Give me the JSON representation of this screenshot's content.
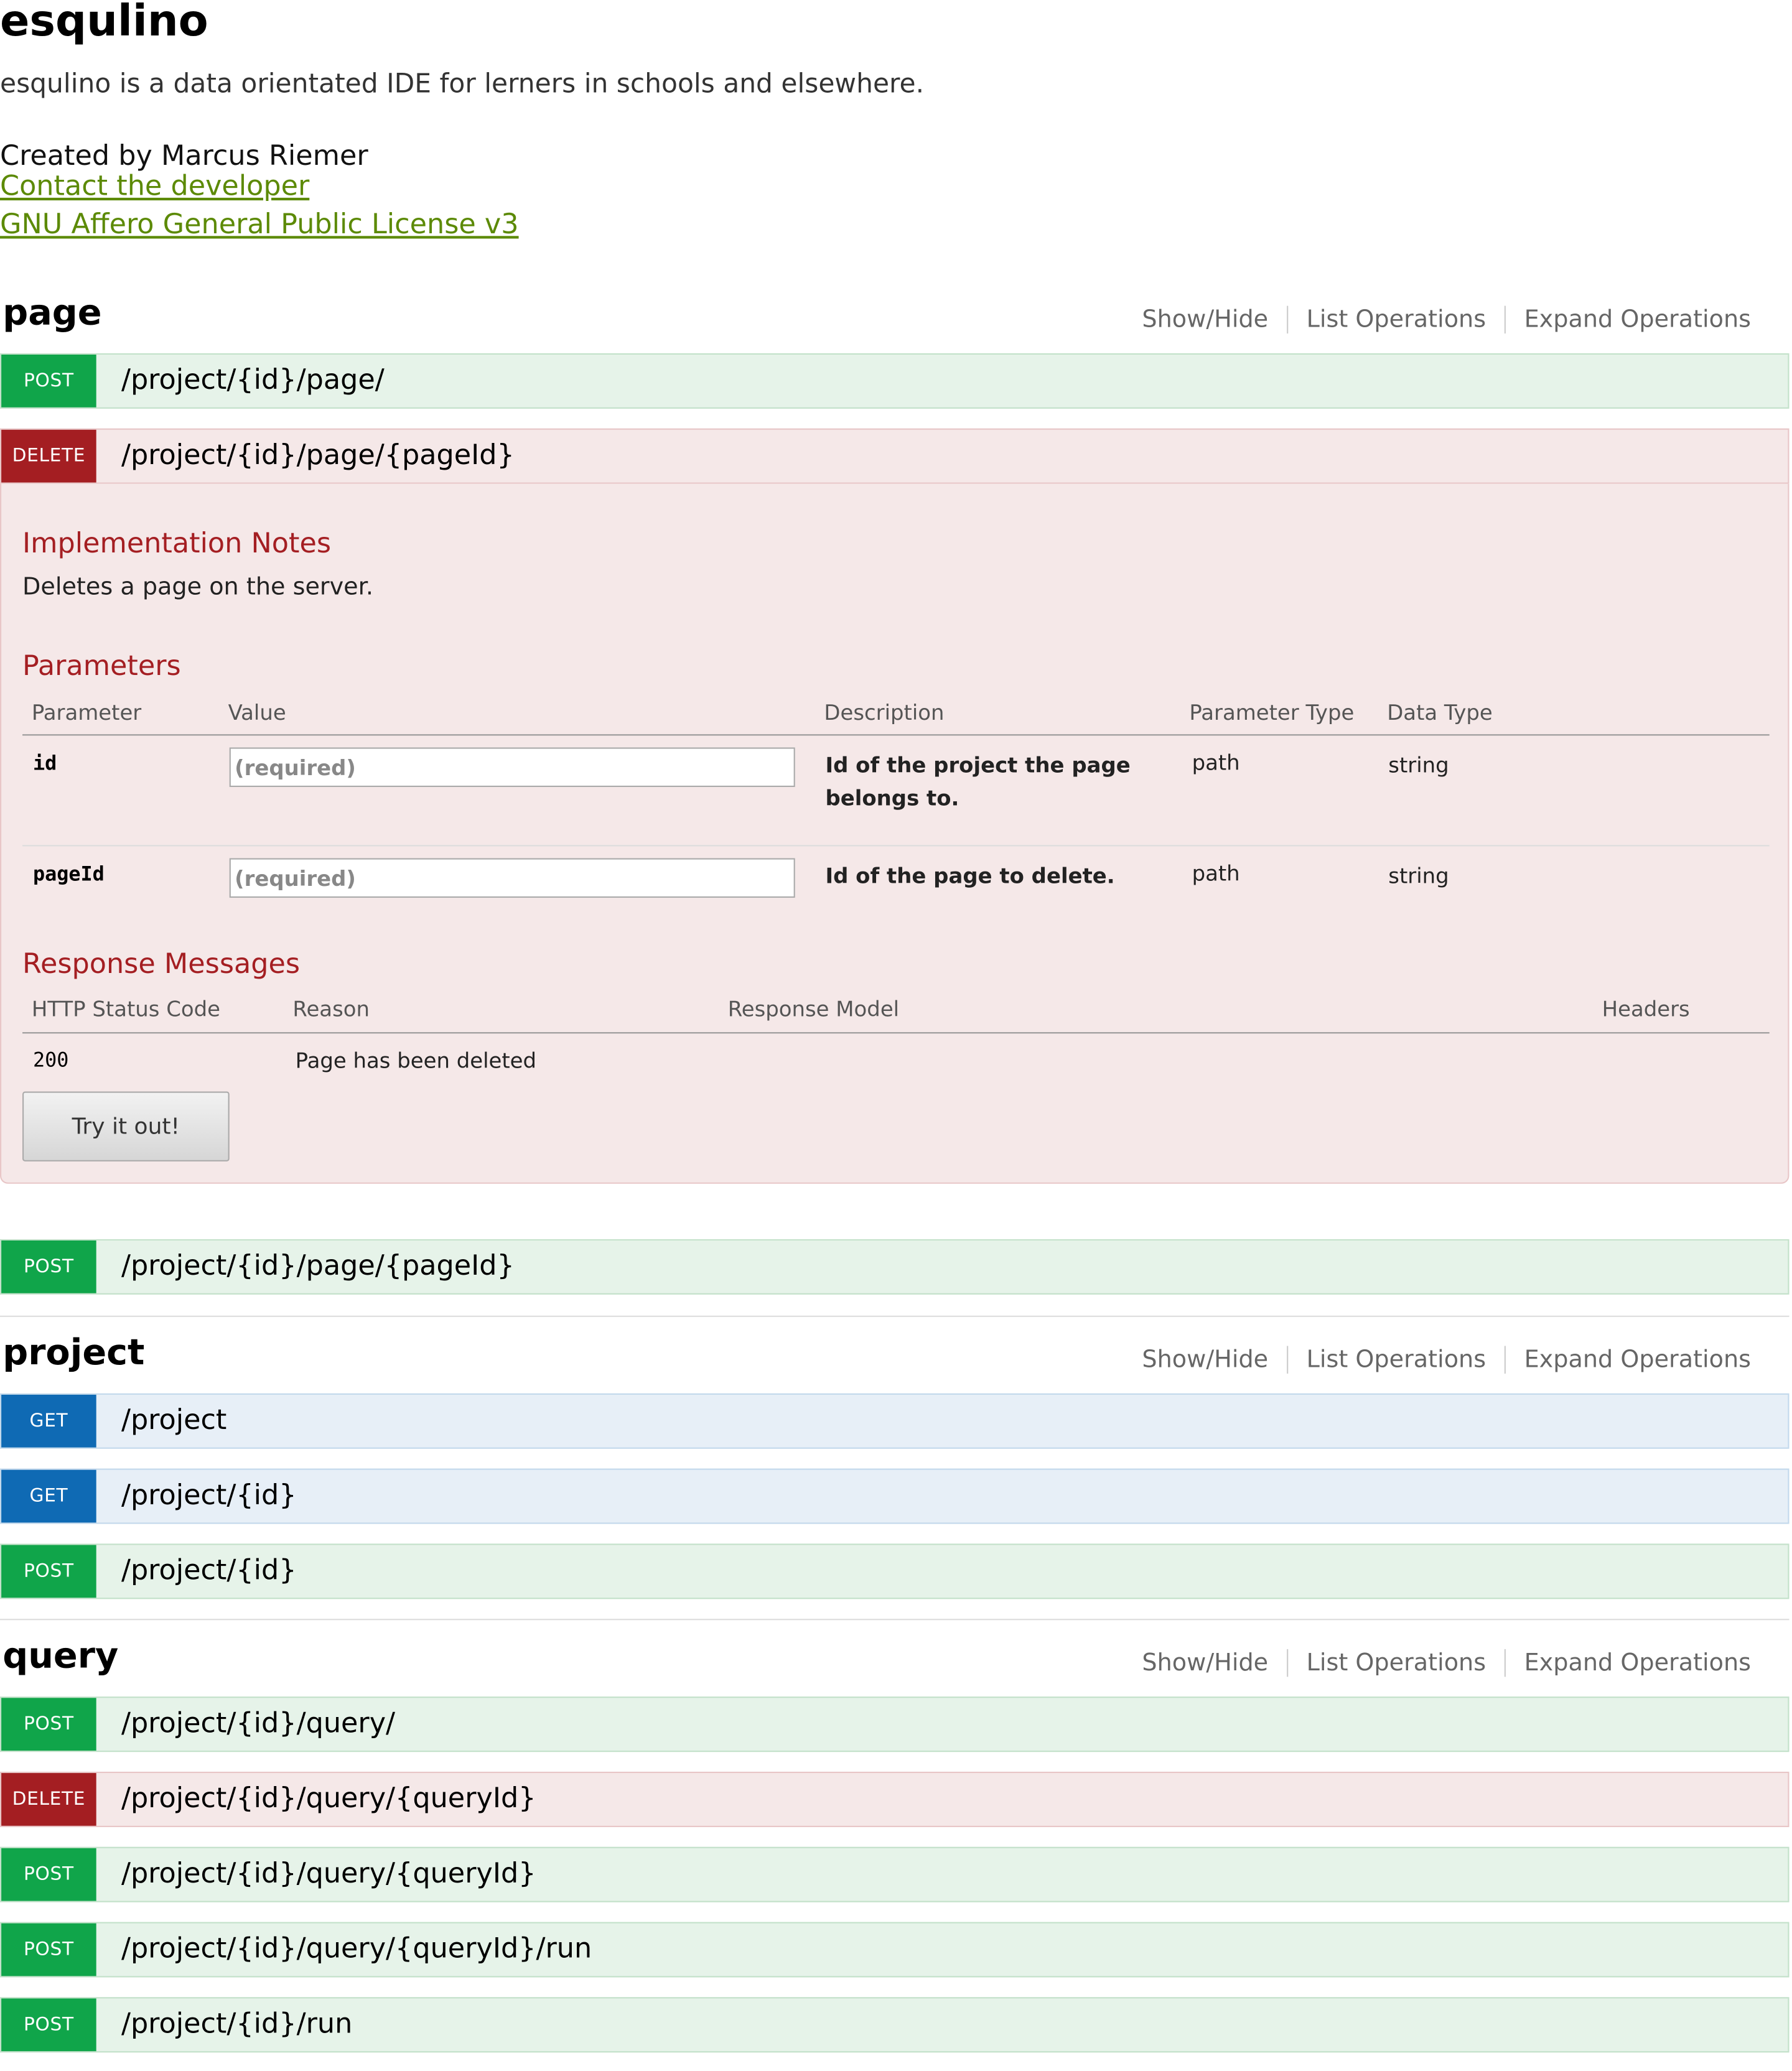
{
  "header": {
    "title": "esqulino",
    "description": "esqulino is a data orientated IDE for lerners in schools and elsewhere.",
    "created_by": "Created by Marcus Riemer",
    "contact_link": "Contact the developer",
    "license_link": "GNU Affero General Public License v3"
  },
  "resource_links": {
    "show_hide": "Show/Hide",
    "list_operations": "List Operations",
    "expand_operations": "Expand Operations"
  },
  "resources": [
    {
      "name": "page",
      "operations": [
        {
          "method": "POST",
          "path": "/project/{id}/page/"
        },
        {
          "method": "DELETE",
          "path": "/project/{id}/page/{pageId}"
        },
        {
          "method": "POST",
          "path": "/project/{id}/page/{pageId}"
        }
      ]
    },
    {
      "name": "project",
      "operations": [
        {
          "method": "GET",
          "path": "/project"
        },
        {
          "method": "GET",
          "path": "/project/{id}"
        },
        {
          "method": "POST",
          "path": "/project/{id}"
        }
      ]
    },
    {
      "name": "query",
      "operations": [
        {
          "method": "POST",
          "path": "/project/{id}/query/"
        },
        {
          "method": "DELETE",
          "path": "/project/{id}/query/{queryId}"
        },
        {
          "method": "POST",
          "path": "/project/{id}/query/{queryId}"
        },
        {
          "method": "POST",
          "path": "/project/{id}/query/{queryId}/run"
        },
        {
          "method": "POST",
          "path": "/project/{id}/run"
        }
      ]
    }
  ],
  "expanded": {
    "implementation_notes_title": "Implementation Notes",
    "implementation_notes": "Deletes a page on the server.",
    "parameters_title": "Parameters",
    "param_headers": {
      "parameter": "Parameter",
      "value": "Value",
      "description": "Description",
      "parameter_type": "Parameter Type",
      "data_type": "Data Type"
    },
    "parameters": [
      {
        "name": "id",
        "placeholder": "(required)",
        "description": "Id of the project the page belongs to.",
        "param_type": "path",
        "data_type": "string"
      },
      {
        "name": "pageId",
        "placeholder": "(required)",
        "description": "Id of the page to delete.",
        "param_type": "path",
        "data_type": "string"
      }
    ],
    "responses_title": "Response Messages",
    "response_headers": {
      "status_code": "HTTP Status Code",
      "reason": "Reason",
      "model": "Response Model",
      "headers": "Headers"
    },
    "responses": [
      {
        "code": "200",
        "reason": "Page has been deleted"
      }
    ],
    "try_button": "Try it out!"
  },
  "colors": {
    "post": "#10a54a",
    "delete": "#a41e22",
    "get": "#0f6ab4",
    "link": "#5c8a06"
  }
}
